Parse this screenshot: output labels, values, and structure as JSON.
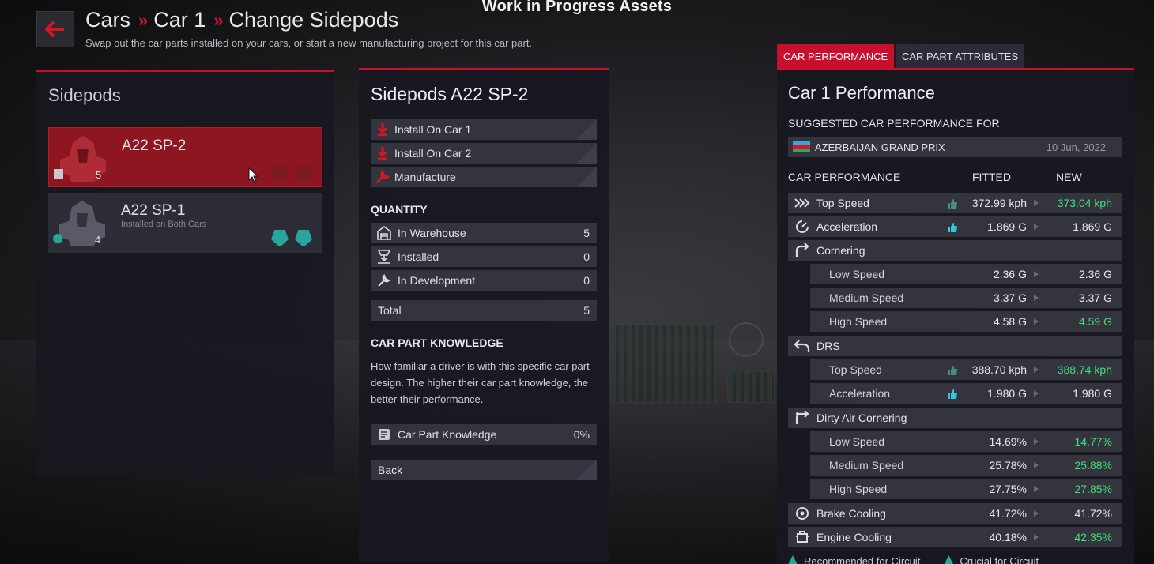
{
  "header": {
    "screen_title": "Work in Progress Assets",
    "breadcrumb": [
      "Cars",
      "Car 1",
      "Change Sidepods"
    ],
    "subtitle": "Swap out the car parts installed on your cars, or start a new manufacturing project for this car part."
  },
  "left_panel": {
    "title": "Sidepods",
    "parts": [
      {
        "name": "A22 SP-2",
        "sub": "",
        "quantity": "5",
        "selected": true
      },
      {
        "name": "A22 SP-1",
        "sub": "Installed on Both Cars",
        "quantity": "4",
        "selected": false
      }
    ]
  },
  "middle_panel": {
    "title": "Sidepods A22 SP-2",
    "actions": [
      "Install On Car 1",
      "Install On Car 2",
      "Manufacture"
    ],
    "quantity_heading": "QUANTITY",
    "quantity": [
      {
        "label": "In Warehouse",
        "value": "5",
        "icon": "warehouse-icon"
      },
      {
        "label": "Installed",
        "value": "0",
        "icon": "installed-icon"
      },
      {
        "label": "In Development",
        "value": "0",
        "icon": "wrench-icon"
      }
    ],
    "total_label": "Total",
    "total_value": "5",
    "knowledge_heading": "CAR PART KNOWLEDGE",
    "knowledge_text": "How familiar a driver is with this specific car part design. The higher their car part knowledge, the better their performance.",
    "knowledge_label": "Car Part Knowledge",
    "knowledge_value": "0%",
    "back_label": "Back"
  },
  "right_panel": {
    "tabs": [
      "CAR PERFORMANCE",
      "CAR PART ATTRIBUTES"
    ],
    "title": "Car 1 Performance",
    "suggested_label": "SUGGESTED CAR PERFORMANCE FOR",
    "grand_prix": "AZERBAIJAN GRAND PRIX",
    "date": "10 Jun, 2022",
    "col_category": "CAR PERFORMANCE",
    "col_fitted": "FITTED",
    "col_new": "NEW",
    "rows": {
      "top_speed": {
        "label": "Top Speed",
        "fitted": "372.99 kph",
        "new": "373.04 kph"
      },
      "acceleration": {
        "label": "Acceleration",
        "fitted": "1.869 G",
        "new": "1.869 G"
      },
      "cornering": {
        "label": "Cornering"
      },
      "corner_low": {
        "label": "Low Speed",
        "fitted": "2.36 G",
        "new": "2.36 G"
      },
      "corner_med": {
        "label": "Medium Speed",
        "fitted": "3.37 G",
        "new": "3.37 G"
      },
      "corner_high": {
        "label": "High Speed",
        "fitted": "4.58 G",
        "new": "4.59 G"
      },
      "drs": {
        "label": "DRS"
      },
      "drs_top": {
        "label": "Top Speed",
        "fitted": "388.70 kph",
        "new": "388.74 kph"
      },
      "drs_acc": {
        "label": "Acceleration",
        "fitted": "1.980 G",
        "new": "1.980 G"
      },
      "dirty": {
        "label": "Dirty Air Cornering"
      },
      "dirty_low": {
        "label": "Low Speed",
        "fitted": "14.69%",
        "new": "14.77%"
      },
      "dirty_med": {
        "label": "Medium Speed",
        "fitted": "25.78%",
        "new": "25.88%"
      },
      "dirty_high": {
        "label": "High Speed",
        "fitted": "27.75%",
        "new": "27.85%"
      },
      "brake": {
        "label": "Brake Cooling",
        "fitted": "41.72%",
        "new": "41.72%"
      },
      "engine": {
        "label": "Engine Cooling",
        "fitted": "40.18%",
        "new": "42.35%"
      }
    },
    "legend": [
      "Recommended for Circuit",
      "Crucial for Circuit"
    ]
  },
  "colors": {
    "accent": "#c8102e",
    "better": "#3fe07a",
    "teal": "#2aa59b"
  }
}
